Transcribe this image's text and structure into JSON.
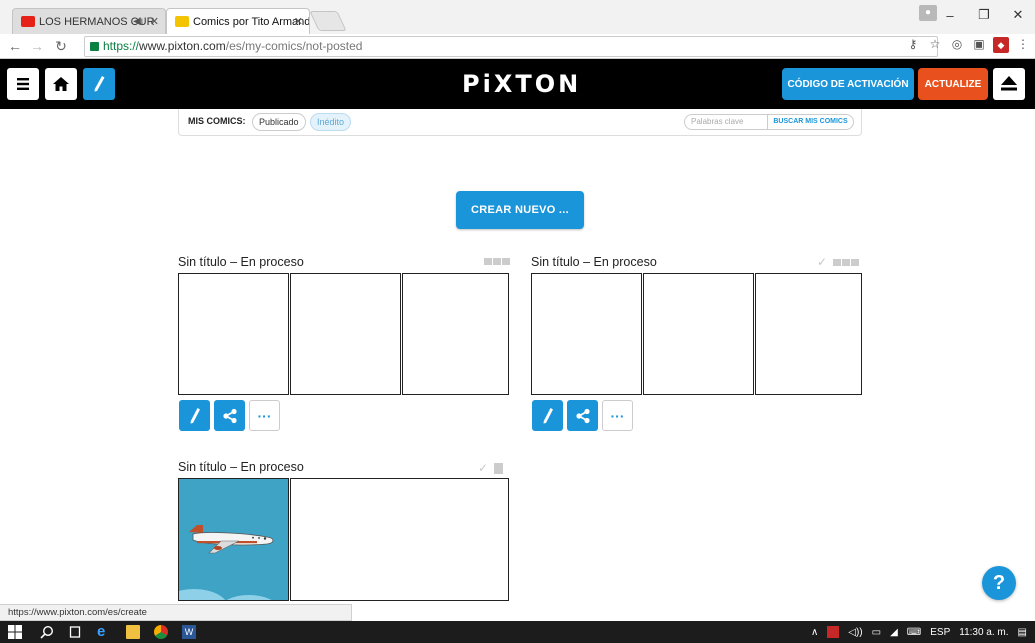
{
  "browser": {
    "tabs": [
      {
        "label": "LOS HERMANOS CUR",
        "active": false
      },
      {
        "label": "Comics por Tito Armand",
        "active": true
      }
    ],
    "url_scheme": "https://",
    "url_host": "www.pixton.com",
    "url_path": "/es/my-comics/not-posted",
    "status_url": "https://www.pixton.com/es/create",
    "window_controls": [
      "–",
      "❐",
      "✕"
    ]
  },
  "header": {
    "logo": "PiXTON",
    "codigo_label": "CÓDIGO DE ACTIVACIÓN",
    "actualize_label": "ACTUALIZE",
    "accent": "#1b95d9",
    "actualize_color": "#e8501d"
  },
  "filter": {
    "label": "MIS COMICS:",
    "tab_published": "Publicado",
    "tab_unpublished": "Inédito",
    "keyword_placeholder": "Palabras clave",
    "search_button": "BUSCAR MIS COMICS"
  },
  "crear_label": "CREAR NUEVO ...",
  "comics": [
    {
      "title": "Sin título – En proceso",
      "panels": 3,
      "checked": false
    },
    {
      "title": "Sin título – En proceso",
      "panels": 3,
      "checked": true
    },
    {
      "title": "Sin título – En proceso",
      "panels": 2,
      "checked": true
    }
  ],
  "help_label": "?",
  "taskbar": {
    "language": "ESP",
    "time": "11:30 a. m."
  }
}
